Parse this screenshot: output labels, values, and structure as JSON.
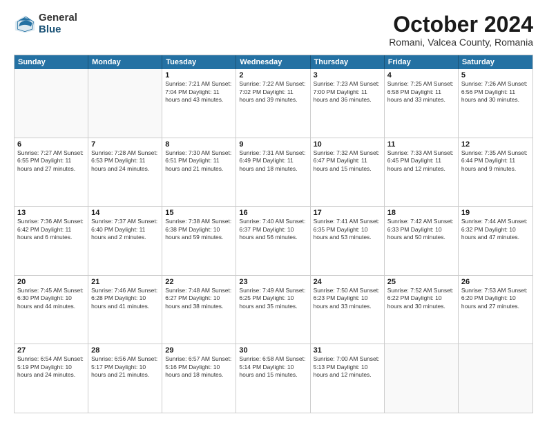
{
  "logo": {
    "general": "General",
    "blue": "Blue"
  },
  "title": "October 2024",
  "subtitle": "Romani, Valcea County, Romania",
  "header_days": [
    "Sunday",
    "Monday",
    "Tuesday",
    "Wednesday",
    "Thursday",
    "Friday",
    "Saturday"
  ],
  "weeks": [
    [
      {
        "day": "",
        "text": "",
        "empty": true
      },
      {
        "day": "",
        "text": "",
        "empty": true
      },
      {
        "day": "1",
        "text": "Sunrise: 7:21 AM\nSunset: 7:04 PM\nDaylight: 11 hours and 43 minutes."
      },
      {
        "day": "2",
        "text": "Sunrise: 7:22 AM\nSunset: 7:02 PM\nDaylight: 11 hours and 39 minutes."
      },
      {
        "day": "3",
        "text": "Sunrise: 7:23 AM\nSunset: 7:00 PM\nDaylight: 11 hours and 36 minutes."
      },
      {
        "day": "4",
        "text": "Sunrise: 7:25 AM\nSunset: 6:58 PM\nDaylight: 11 hours and 33 minutes."
      },
      {
        "day": "5",
        "text": "Sunrise: 7:26 AM\nSunset: 6:56 PM\nDaylight: 11 hours and 30 minutes."
      }
    ],
    [
      {
        "day": "6",
        "text": "Sunrise: 7:27 AM\nSunset: 6:55 PM\nDaylight: 11 hours and 27 minutes."
      },
      {
        "day": "7",
        "text": "Sunrise: 7:28 AM\nSunset: 6:53 PM\nDaylight: 11 hours and 24 minutes."
      },
      {
        "day": "8",
        "text": "Sunrise: 7:30 AM\nSunset: 6:51 PM\nDaylight: 11 hours and 21 minutes."
      },
      {
        "day": "9",
        "text": "Sunrise: 7:31 AM\nSunset: 6:49 PM\nDaylight: 11 hours and 18 minutes."
      },
      {
        "day": "10",
        "text": "Sunrise: 7:32 AM\nSunset: 6:47 PM\nDaylight: 11 hours and 15 minutes."
      },
      {
        "day": "11",
        "text": "Sunrise: 7:33 AM\nSunset: 6:45 PM\nDaylight: 11 hours and 12 minutes."
      },
      {
        "day": "12",
        "text": "Sunrise: 7:35 AM\nSunset: 6:44 PM\nDaylight: 11 hours and 9 minutes."
      }
    ],
    [
      {
        "day": "13",
        "text": "Sunrise: 7:36 AM\nSunset: 6:42 PM\nDaylight: 11 hours and 6 minutes."
      },
      {
        "day": "14",
        "text": "Sunrise: 7:37 AM\nSunset: 6:40 PM\nDaylight: 11 hours and 2 minutes."
      },
      {
        "day": "15",
        "text": "Sunrise: 7:38 AM\nSunset: 6:38 PM\nDaylight: 10 hours and 59 minutes."
      },
      {
        "day": "16",
        "text": "Sunrise: 7:40 AM\nSunset: 6:37 PM\nDaylight: 10 hours and 56 minutes."
      },
      {
        "day": "17",
        "text": "Sunrise: 7:41 AM\nSunset: 6:35 PM\nDaylight: 10 hours and 53 minutes."
      },
      {
        "day": "18",
        "text": "Sunrise: 7:42 AM\nSunset: 6:33 PM\nDaylight: 10 hours and 50 minutes."
      },
      {
        "day": "19",
        "text": "Sunrise: 7:44 AM\nSunset: 6:32 PM\nDaylight: 10 hours and 47 minutes."
      }
    ],
    [
      {
        "day": "20",
        "text": "Sunrise: 7:45 AM\nSunset: 6:30 PM\nDaylight: 10 hours and 44 minutes."
      },
      {
        "day": "21",
        "text": "Sunrise: 7:46 AM\nSunset: 6:28 PM\nDaylight: 10 hours and 41 minutes."
      },
      {
        "day": "22",
        "text": "Sunrise: 7:48 AM\nSunset: 6:27 PM\nDaylight: 10 hours and 38 minutes."
      },
      {
        "day": "23",
        "text": "Sunrise: 7:49 AM\nSunset: 6:25 PM\nDaylight: 10 hours and 35 minutes."
      },
      {
        "day": "24",
        "text": "Sunrise: 7:50 AM\nSunset: 6:23 PM\nDaylight: 10 hours and 33 minutes."
      },
      {
        "day": "25",
        "text": "Sunrise: 7:52 AM\nSunset: 6:22 PM\nDaylight: 10 hours and 30 minutes."
      },
      {
        "day": "26",
        "text": "Sunrise: 7:53 AM\nSunset: 6:20 PM\nDaylight: 10 hours and 27 minutes."
      }
    ],
    [
      {
        "day": "27",
        "text": "Sunrise: 6:54 AM\nSunset: 5:19 PM\nDaylight: 10 hours and 24 minutes."
      },
      {
        "day": "28",
        "text": "Sunrise: 6:56 AM\nSunset: 5:17 PM\nDaylight: 10 hours and 21 minutes."
      },
      {
        "day": "29",
        "text": "Sunrise: 6:57 AM\nSunset: 5:16 PM\nDaylight: 10 hours and 18 minutes."
      },
      {
        "day": "30",
        "text": "Sunrise: 6:58 AM\nSunset: 5:14 PM\nDaylight: 10 hours and 15 minutes."
      },
      {
        "day": "31",
        "text": "Sunrise: 7:00 AM\nSunset: 5:13 PM\nDaylight: 10 hours and 12 minutes."
      },
      {
        "day": "",
        "text": "",
        "empty": true
      },
      {
        "day": "",
        "text": "",
        "empty": true
      }
    ]
  ]
}
